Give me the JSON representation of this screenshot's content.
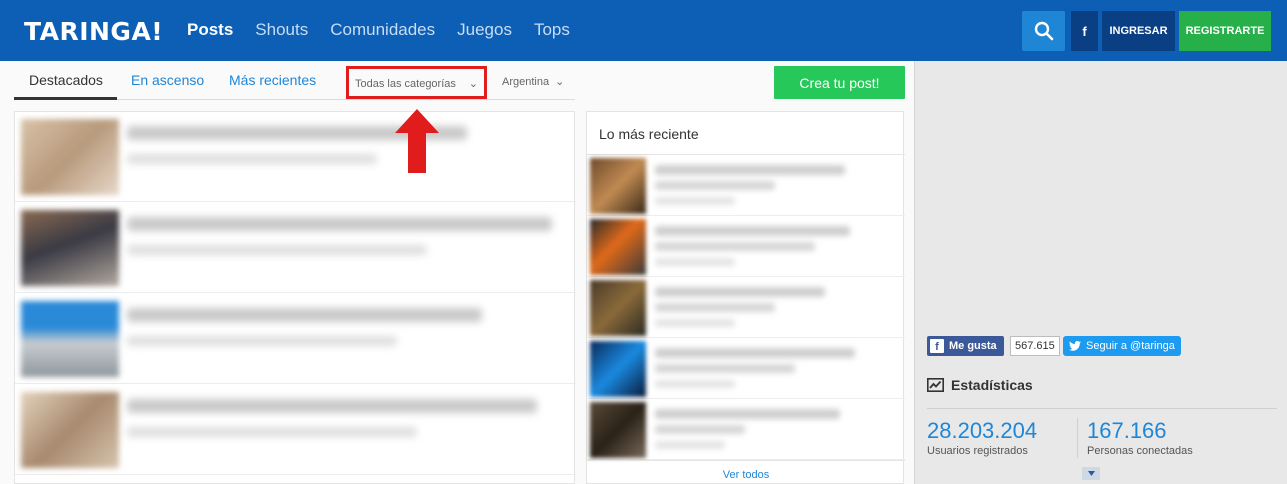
{
  "header": {
    "logo": "TARINGA!",
    "nav": [
      "Posts",
      "Shouts",
      "Comunidades",
      "Juegos",
      "Tops"
    ],
    "facebook_label": "f",
    "login_label": "INGRESAR",
    "register_label": "REGISTRARTE"
  },
  "filters": {
    "tabs": [
      "Destacados",
      "En ascenso",
      "Más recientes"
    ],
    "category_value": "Todas las categorías",
    "country_value": "Argentina",
    "create_label": "Crea tu post!"
  },
  "recent": {
    "title": "Lo más reciente",
    "see_all_label": "Ver todos"
  },
  "sidebar": {
    "like_label": "Me gusta",
    "like_count": "567.615",
    "twitter_label": "Seguir a @taringa",
    "stats_title": "Estadísticas",
    "registered_users": "28.203.204",
    "registered_users_label": "Usuarios registrados",
    "online_users": "167.166",
    "online_users_label": "Personas conectadas"
  },
  "colors": {
    "brand_blue": "#0c5fb5",
    "accent_green": "#27b04a",
    "link_blue": "#1f86d6",
    "highlight_red": "#e11c1c"
  }
}
